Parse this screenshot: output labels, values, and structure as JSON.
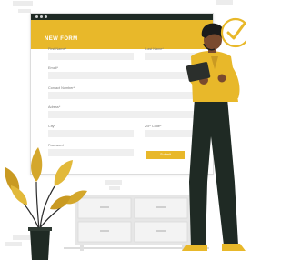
{
  "form": {
    "title": "NEW FORM",
    "fields": {
      "first_name": "First Name*",
      "last_name": "Last Name*",
      "email": "Email*",
      "contact_number": "Contact Number*",
      "adress": "Adress*",
      "city": "City*",
      "zip_code": "ZIP Code*",
      "password": "Password"
    },
    "submit_label": "Submit"
  },
  "colors": {
    "accent": "#e8b82a",
    "dark": "#1f2a24",
    "skin": "#7a4a2e",
    "hair": "#1b1b1b",
    "shirt": "#e8b82a",
    "trousers": "#1f2a24",
    "plant_leaf": "#d4a72c",
    "plant_stem": "#2b2b2b",
    "pot": "#1f2a24",
    "cabinet": "#e6e6e6",
    "background_shape": "#ececec"
  },
  "icons": [
    "checkmark-badge-icon",
    "tablet-icon",
    "plant-illustration",
    "cabinet-illustration",
    "person-illustration"
  ]
}
